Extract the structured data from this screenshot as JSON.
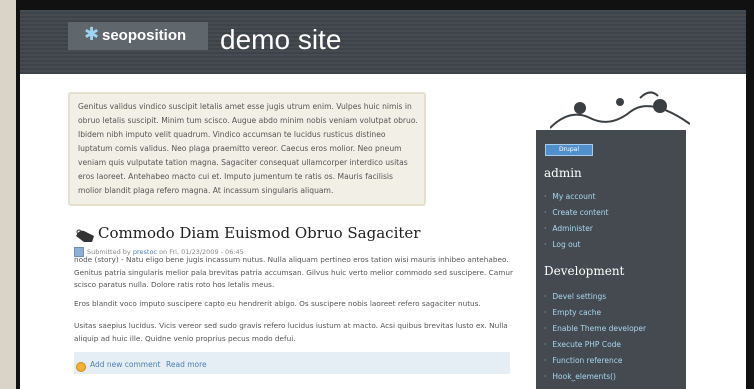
{
  "header": {
    "logo_text": "seoposition",
    "site_title": "demo site"
  },
  "mission": "Genitus validus vindico suscipit letalis amet esse jugis utrum enim. Vulpes huic nimis in obruo letalis suscipit. Minim tum scisco. Augue abdo minim nobis veniam volutpat obruo. Ibidem nibh imputo velit quadrum. Vindico accumsan te lucidus rusticus distineo luptatum comis validus. Neo plaga praemitto vereor. Caecus eros molior. Neo pneum veniam quis vulputate tation magna. Sagaciter consequat ullamcorper interdico usitas eros laoreet. Antehabeo macto cui et. Imputo jumentum te ratis os. Mauris facilisis molior blandit plaga refero magna. At incassum singularis aliquam.",
  "node": {
    "title": "Commodo Diam Euismod Obruo Sagaciter",
    "submitted_prefix": "Submitted by",
    "author": "prestoc",
    "submitted_suffix": "on Fri, 01/23/2009 - 06:45",
    "paragraphs": [
      "node (story) - Natu eligo bene jugis incassum nutus. Nulla aliquam pertineo eros tation wisi mauris inhibeo antehabeo. Genitus patria singularis melior pala brevitas patria accumsan. Gilvus huic verto melior commodo sed suscipere. Camur scisco paratus nulla. Dolore ratis roto hos letalis meus.",
      "Eros blandit voco imputo suscipere capto eu hendrerit abigo. Os suscipere nobis laoreet refero sagaciter nutus.",
      "Usitas saepius lucidus. Vicis vereor sed sudo gravis refero lucidus iustum at macto. Acsi quibus brevitas lusto ex. Nulla aliquip ad huic ille. Quidne venio proprius pecus modo defui."
    ],
    "add_comment": "Add new comment",
    "read_more": "Read more"
  },
  "sidebar": {
    "badge": "Drupal",
    "admin_title": "admin",
    "admin_items": [
      "My account",
      "Create content",
      "Administer",
      "Log out"
    ],
    "dev_title": "Development",
    "dev_items": [
      "Devel settings",
      "Empty cache",
      "Enable Theme developer",
      "Execute PHP Code",
      "Function reference",
      "Hook_elements()"
    ]
  }
}
